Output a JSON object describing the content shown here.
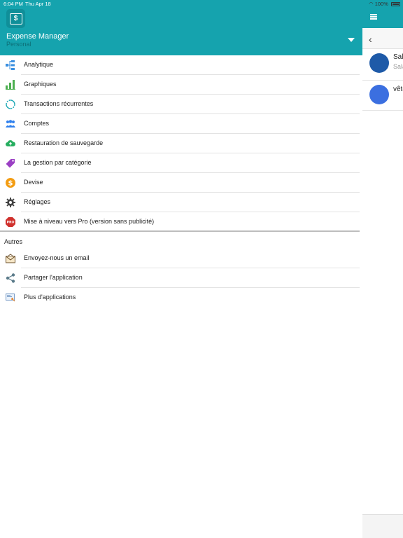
{
  "status_bar": {
    "time": "6:04 PM",
    "date": "Thu Apr 18",
    "battery": "100%"
  },
  "drawer": {
    "app_name": "Expense Manager",
    "account": "Personal",
    "main_items": [
      {
        "label": "Analytique",
        "icon": "analytics-icon"
      },
      {
        "label": "Graphiques",
        "icon": "bar-chart-icon"
      },
      {
        "label": "Transactions récurrentes",
        "icon": "recurring-icon"
      },
      {
        "label": "Comptes",
        "icon": "accounts-icon"
      },
      {
        "label": "Restauration de sauvegarde",
        "icon": "cloud-upload-icon"
      },
      {
        "label": "La gestion par catégorie",
        "icon": "tag-icon"
      },
      {
        "label": "Devise",
        "icon": "currency-icon"
      },
      {
        "label": "Réglages",
        "icon": "gear-icon"
      },
      {
        "label": "Mise à niveau vers Pro (version sans publicité)",
        "icon": "pro-icon"
      }
    ],
    "section_other": "Autres",
    "other_items": [
      {
        "label": "Envoyez-nous un email",
        "icon": "email-icon"
      },
      {
        "label": "Partager l'application",
        "icon": "share-icon"
      },
      {
        "label": "Plus d'applications",
        "icon": "more-apps-icon"
      }
    ]
  },
  "background": {
    "rows": [
      {
        "title": "Sala",
        "subtitle": "Sala"
      },
      {
        "title": "vête",
        "subtitle": ""
      }
    ]
  },
  "colors": {
    "brand": "#15a3ae"
  }
}
